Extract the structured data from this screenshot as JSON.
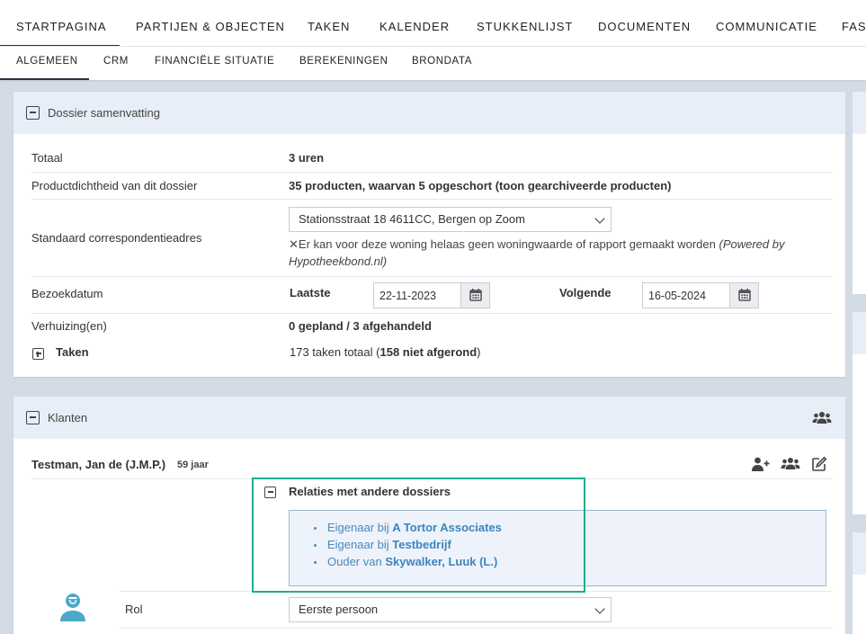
{
  "top_tabs": [
    "STARTPAGINA",
    "PARTIJEN & OBJECTEN",
    "TAKEN",
    "KALENDER",
    "STUKKENLIJST",
    "DOCUMENTEN",
    "COMMUNICATIE",
    "FAS"
  ],
  "sub_tabs": [
    "ALGEMEEN",
    "CRM",
    "FINANCIËLE SITUATIE",
    "BEREKENINGEN",
    "BRONDATA"
  ],
  "summary": {
    "title": "Dossier samenvatting",
    "totaal_label": "Totaal",
    "totaal_value": "3 uren",
    "density_label": "Productdichtheid van dit dossier",
    "density_value": "35 producten, waarvan 5 opgeschort (toon gearchiveerde producten)",
    "address_label": "Standaard correspondentieadres",
    "address_value": "Stationsstraat 18 4611CC, Bergen op Zoom",
    "address_warning_mark": "✕",
    "address_warning": "Er kan voor deze woning helaas geen woningwaarde of rapport gemaakt worden",
    "address_warning_powered": "(Powered by Hypotheekbond.nl)",
    "visit_label": "Bezoekdatum",
    "last_label": "Laatste",
    "last_value": "22-11-2023",
    "next_label": "Volgende",
    "next_value": "16-05-2024",
    "moves_label": "Verhuizing(en)",
    "moves_value": "0 gepland / 3 afgehandeld",
    "tasks_label": "Taken",
    "tasks_total": "173 taken totaal",
    "tasks_open_prefix": "(",
    "tasks_open": "158 niet afgerond",
    "tasks_open_suffix": ")"
  },
  "clients": {
    "title": "Klanten",
    "client_name": "Testman, Jan de (J.M.P.)",
    "client_age": "59 jaar",
    "relations_title": "Relaties met andere dossiers",
    "relations": [
      {
        "prefix": "Eigenaar bij",
        "name": "A Tortor Associates"
      },
      {
        "prefix": "Eigenaar bij",
        "name": "Testbedrijf"
      },
      {
        "prefix": "Ouder van",
        "name": "Skywalker, Luuk (L.)"
      }
    ],
    "role_label": "Rol",
    "role_value": "Eerste persoon"
  },
  "colors": {
    "accent": "#1fae8f",
    "link": "#3a86bd",
    "header_bg": "#e8eef7",
    "page_bg": "#d3dbe5",
    "avatar": "#4aa9c9"
  },
  "icons": [
    "calendar-icon",
    "users-icon",
    "add-user-icon",
    "edit-icon",
    "person-avatar-icon"
  ]
}
